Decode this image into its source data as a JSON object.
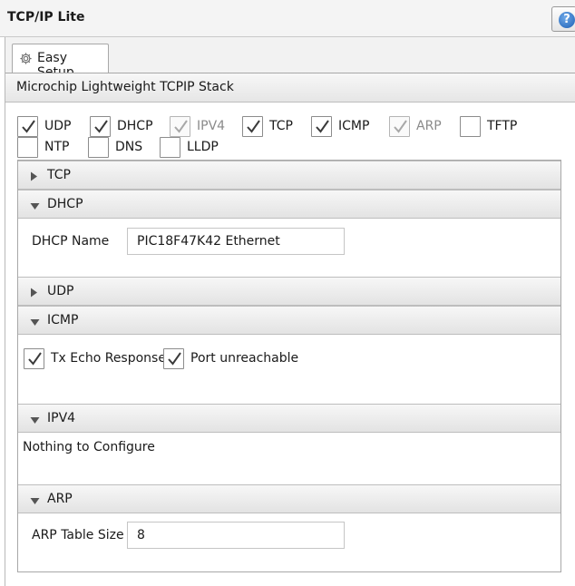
{
  "window": {
    "title": "TCP/IP Lite",
    "help_glyph": "?"
  },
  "tabs": [
    {
      "label": "Easy Setup",
      "icon": "gear-icon"
    }
  ],
  "stack_title": "Microchip Lightweight TCPIP Stack",
  "protocols": [
    {
      "label": "UDP",
      "checked": true,
      "enabled": true
    },
    {
      "label": "DHCP",
      "checked": true,
      "enabled": true
    },
    {
      "label": "IPV4",
      "checked": true,
      "enabled": false
    },
    {
      "label": "TCP",
      "checked": true,
      "enabled": true
    },
    {
      "label": "ICMP",
      "checked": true,
      "enabled": true
    },
    {
      "label": "ARP",
      "checked": true,
      "enabled": false
    },
    {
      "label": "TFTP",
      "checked": false,
      "enabled": true
    },
    {
      "label": "NTP",
      "checked": false,
      "enabled": true
    },
    {
      "label": "DNS",
      "checked": false,
      "enabled": true
    },
    {
      "label": "LLDP",
      "checked": false,
      "enabled": true
    }
  ],
  "sections": {
    "tcp": {
      "label": "TCP",
      "expanded": false
    },
    "dhcp": {
      "label": "DHCP",
      "expanded": true,
      "field_label": "DHCP Name",
      "field_value": "PIC18F47K42 Ethernet"
    },
    "udp": {
      "label": "UDP",
      "expanded": false
    },
    "icmp": {
      "label": "ICMP",
      "expanded": true,
      "options": [
        {
          "label": "Tx Echo Response",
          "checked": true
        },
        {
          "label": "Port unreachable",
          "checked": true
        }
      ]
    },
    "ipv4": {
      "label": "IPV4",
      "expanded": true,
      "message": "Nothing to Configure"
    },
    "arp": {
      "label": "ARP",
      "expanded": true,
      "field_label": "ARP Table Size",
      "field_value": "8"
    }
  },
  "colors": {
    "check_enabled": "#3a3a3a",
    "check_disabled": "#a8a8a8",
    "help_blue": "#1c5fb5"
  }
}
